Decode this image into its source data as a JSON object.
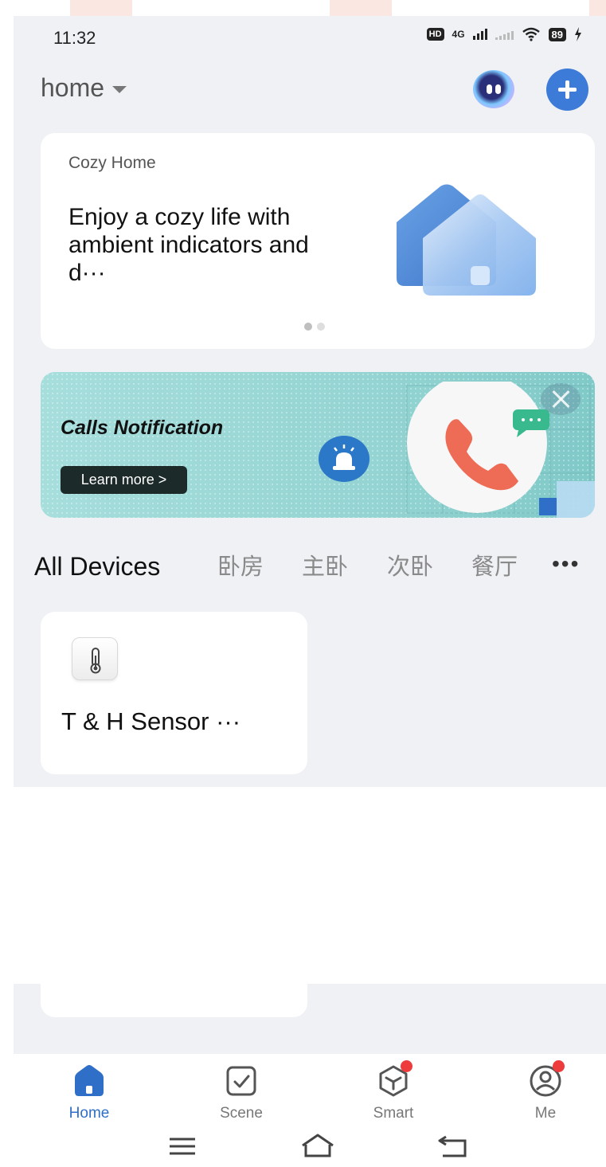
{
  "status_bar": {
    "time": "11:32",
    "hd": "HD",
    "network": "4G",
    "battery": "89"
  },
  "header": {
    "home_name": "home"
  },
  "hero": {
    "kicker": "Cozy Home",
    "headline": "Enjoy a cozy life with ambient indicators and d···",
    "page_count": 2,
    "active_page": 1
  },
  "promo": {
    "title": "Calls Notification",
    "button_label": "Learn more >"
  },
  "tabs": [
    {
      "label": "All Devices",
      "active": true
    },
    {
      "label": "卧房",
      "active": false
    },
    {
      "label": "主卧",
      "active": false
    },
    {
      "label": "次卧",
      "active": false
    },
    {
      "label": "餐厅",
      "active": false
    }
  ],
  "more_tabs_label": "•••",
  "devices": [
    {
      "name": "T & H Sensor ···",
      "icon": "thermometer-icon"
    }
  ],
  "bottom_nav": [
    {
      "label": "Home",
      "icon": "home-icon",
      "active": true,
      "badge": false
    },
    {
      "label": "Scene",
      "icon": "scene-check-icon",
      "active": false,
      "badge": false
    },
    {
      "label": "Smart",
      "icon": "smart-cube-icon",
      "active": false,
      "badge": true
    },
    {
      "label": "Me",
      "icon": "profile-icon",
      "active": false,
      "badge": true
    }
  ],
  "colors": {
    "accent": "#3d7bd8",
    "active_nav": "#2f6fc7",
    "background": "#f0f1f5",
    "badge": "#ee3b3b",
    "promo_bg": "#94d4d2"
  }
}
